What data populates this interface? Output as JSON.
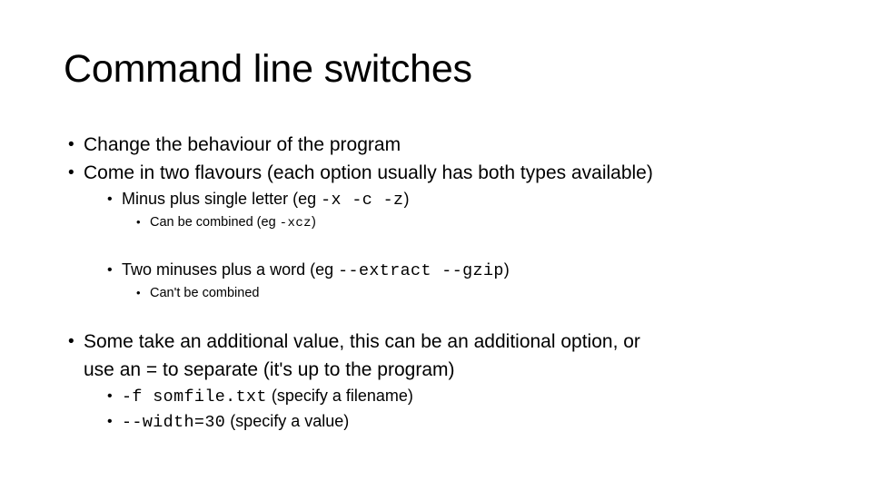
{
  "slide": {
    "title": "Command line switches",
    "bullet_glyph": "•",
    "text_color": "#000000",
    "background_color": "#ffffff",
    "content": [
      {
        "level": 1,
        "id": "change-behaviour",
        "text": "Change the behaviour of the program"
      },
      {
        "level": 1,
        "id": "two-flavours",
        "text": "Come in two flavours (each option usually has both types available)"
      },
      {
        "level": 2,
        "id": "minus-single-letter",
        "prefix": "Minus plus single letter (eg ",
        "code": "-x  -c  -z",
        "suffix": ")"
      },
      {
        "level": 3,
        "id": "can-be-combined",
        "prefix": "Can be combined (eg ",
        "code": "-xcz",
        "suffix": ")"
      },
      {
        "level": 2,
        "id": "two-minuses-word",
        "prefix": "Two minuses plus a word (eg ",
        "code": "--extract  --gzip",
        "suffix": ")"
      },
      {
        "level": 3,
        "id": "cant-be-combined",
        "text": "Can't be combined"
      },
      {
        "level": 1,
        "id": "additional-value",
        "line1": "Some take an additional value, this can be an additional option, or",
        "line2": "use an = to separate (it's up to the program)"
      },
      {
        "level": 2,
        "id": "f-somfile",
        "code": "-f somfile.txt",
        "suffix": " (specify a filename)"
      },
      {
        "level": 2,
        "id": "width-30",
        "code": "--width=30",
        "suffix": " (specify a value)"
      }
    ]
  }
}
